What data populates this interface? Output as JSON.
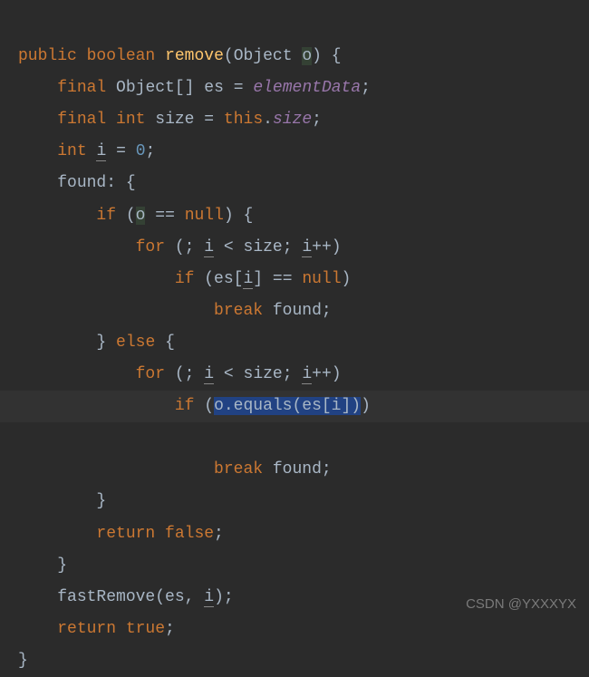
{
  "code": {
    "line1": {
      "kw_public": "public",
      "kw_boolean": "boolean",
      "method": "remove",
      "type": "Object",
      "param": "o",
      "brace": ") {"
    },
    "line2": {
      "kw_final": "final",
      "type": "Object[]",
      "var": "es",
      "eq": "=",
      "field": "elementData",
      "semi": ";"
    },
    "line3": {
      "kw_final": "final",
      "kw_int": "int",
      "var": "size",
      "eq": "=",
      "kw_this": "this",
      "dot": ".",
      "field": "size",
      "semi": ";"
    },
    "line4": {
      "kw_int": "int",
      "var": "i",
      "eq": "=",
      "num": "0",
      "semi": ";"
    },
    "line5": {
      "label": "found: {"
    },
    "line6": {
      "kw_if": "if",
      "open": "(",
      "param": "o",
      "eq": "==",
      "kw_null": "null",
      "close": ") {"
    },
    "line7": {
      "kw_for": "for",
      "open": "(;",
      "var": "i",
      "lt": "<",
      "size": "size;",
      "var2": "i",
      "inc": "++)"
    },
    "line8": {
      "kw_if": "if",
      "open": "(es[",
      "var": "i",
      "close": "]",
      "eq": "==",
      "kw_null": "null",
      "close2": ")"
    },
    "line9": {
      "kw_break": "break",
      "label": "found;"
    },
    "line10": {
      "close": "}",
      "kw_else": "else",
      "open": "{"
    },
    "line11": {
      "kw_for": "for",
      "open": "(;",
      "var": "i",
      "lt": "<",
      "size": "size;",
      "var2": "i",
      "inc": "++)"
    },
    "line12": {
      "kw_if": "if",
      "open": "(",
      "sel": "o.equals(es[i])",
      "close": ")"
    },
    "line13": {
      "kw_break": "break",
      "label": "found;"
    },
    "line14": {
      "close": "}"
    },
    "line15": {
      "kw_return": "return false",
      "semi": ";"
    },
    "line16": {
      "close": "}"
    },
    "line17": {
      "method": "fastRemove",
      "open": "(es,",
      "var": "i",
      "close": ");"
    },
    "line18": {
      "kw_return": "return true",
      "semi": ";"
    },
    "line19": {
      "close": "}"
    }
  },
  "watermark": "CSDN @YXXXYX"
}
